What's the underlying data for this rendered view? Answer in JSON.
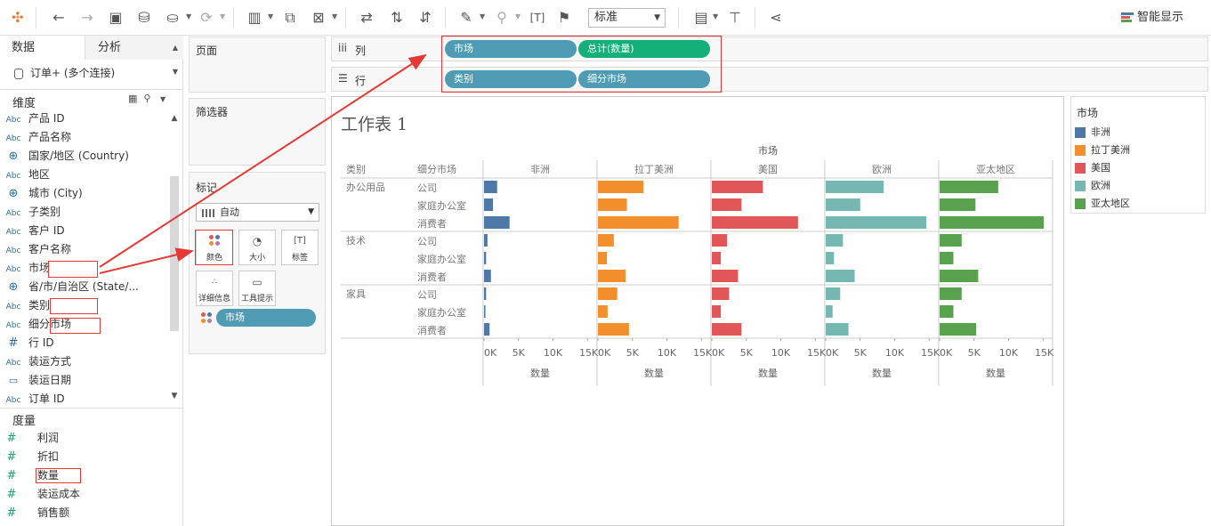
{
  "toolbar": {
    "fit_value": "标准",
    "show_me_label": "智能显示",
    "icons": [
      "tableau-logo-icon",
      "undo-icon",
      "redo-icon",
      "save-icon",
      "new-datasource-icon",
      "pause-update-icon",
      "refresh-icon",
      "new-worksheet-icon",
      "duplicate-icon",
      "clear-sheet-icon",
      "swap-icon",
      "sort-ascending-icon",
      "sort-descending-icon",
      "highlight-icon",
      "group-icon",
      "label-icon",
      "pin-icon",
      "show-cards-icon",
      "presentation-icon",
      "share-icon"
    ]
  },
  "data_pane": {
    "tab_data": "数据",
    "tab_analysis": "分析",
    "datasource": "订单+ (多个连接)",
    "dimensions_header": "维度",
    "dimensions": [
      {
        "type": "Abc",
        "name": "产品 ID"
      },
      {
        "type": "Abc",
        "name": "产品名称"
      },
      {
        "type": "geo",
        "name": "国家/地区 (Country)"
      },
      {
        "type": "Abc",
        "name": "地区"
      },
      {
        "type": "geo",
        "name": "城市 (City)"
      },
      {
        "type": "Abc",
        "name": "子类别"
      },
      {
        "type": "Abc",
        "name": "客户 ID"
      },
      {
        "type": "Abc",
        "name": "客户名称"
      },
      {
        "type": "Abc",
        "name": "市场"
      },
      {
        "type": "geo",
        "name": "省/市/自治区 (State/..."
      },
      {
        "type": "Abc",
        "name": "类别"
      },
      {
        "type": "Abc",
        "name": "细分市场"
      },
      {
        "type": "#",
        "name": "行 ID"
      },
      {
        "type": "Abc",
        "name": "装运方式"
      },
      {
        "type": "cal",
        "name": "装运日期"
      },
      {
        "type": "Abc",
        "name": "订单 ID"
      }
    ],
    "measures_header": "度量",
    "measures": [
      "利润",
      "折扣",
      "数量",
      "装运成本",
      "销售额"
    ]
  },
  "cards": {
    "pages_title": "页面",
    "filters_title": "筛选器",
    "marks_title": "标记",
    "mark_type": "自动",
    "mark_buttons": [
      "颜色",
      "大小",
      "标签",
      "详细信息",
      "工具提示"
    ],
    "color_pill": "市场"
  },
  "shelves": {
    "columns_label": "列",
    "rows_label": "行",
    "column_pills": [
      "市场",
      "总计(数量)"
    ],
    "row_pills": [
      "类别",
      "细分市场"
    ]
  },
  "view": {
    "sheet_title": "工作表 1",
    "top_header": "市场",
    "row_header_category": "类别",
    "row_header_segment": "细分市场"
  },
  "legend": {
    "title": "市场",
    "items": [
      {
        "name": "非洲",
        "color": "#4e79a7"
      },
      {
        "name": "拉丁美洲",
        "color": "#f28e2b"
      },
      {
        "name": "美国",
        "color": "#e15759"
      },
      {
        "name": "欧洲",
        "color": "#76b7b2"
      },
      {
        "name": "亚太地区",
        "color": "#59a14f"
      }
    ]
  },
  "chart_data": {
    "type": "bar",
    "orientation": "horizontal",
    "measure": "数量",
    "panes": [
      "非洲",
      "拉丁美洲",
      "美国",
      "欧洲",
      "亚太地区"
    ],
    "pane_colors": [
      "#4e79a7",
      "#f28e2b",
      "#e15759",
      "#76b7b2",
      "#59a14f"
    ],
    "xlim": [
      0,
      16000
    ],
    "ticks": [
      0,
      5000,
      10000,
      15000
    ],
    "tick_labels": [
      "0K",
      "5K",
      "10K",
      "15K"
    ],
    "xlabel": "数量",
    "categories": [
      {
        "name": "办公用品",
        "segments": [
          "公司",
          "家庭办公室",
          "消费者"
        ]
      },
      {
        "name": "技术",
        "segments": [
          "公司",
          "家庭办公室",
          "消费者"
        ]
      },
      {
        "name": "家具",
        "segments": [
          "公司",
          "家庭办公室",
          "消费者"
        ]
      }
    ],
    "rows": [
      {
        "category": "办公用品",
        "segment": "公司"
      },
      {
        "category": "办公用品",
        "segment": "家庭办公室"
      },
      {
        "category": "办公用品",
        "segment": "消费者"
      },
      {
        "category": "技术",
        "segment": "公司"
      },
      {
        "category": "技术",
        "segment": "家庭办公室"
      },
      {
        "category": "技术",
        "segment": "消费者"
      },
      {
        "category": "家具",
        "segment": "公司"
      },
      {
        "category": "家具",
        "segment": "家庭办公室"
      },
      {
        "category": "家具",
        "segment": "消费者"
      }
    ],
    "series": [
      {
        "name": "非洲",
        "values": [
          1900,
          1300,
          3700,
          500,
          300,
          1000,
          300,
          200,
          800
        ]
      },
      {
        "name": "拉丁美洲",
        "values": [
          6600,
          4200,
          11700,
          2300,
          1300,
          4000,
          2800,
          1400,
          4500
        ]
      },
      {
        "name": "美国",
        "values": [
          7400,
          4300,
          12500,
          2200,
          1300,
          3800,
          2500,
          1300,
          4300
        ]
      },
      {
        "name": "欧洲",
        "values": [
          8400,
          5000,
          14600,
          2500,
          1200,
          4200,
          2100,
          1000,
          3300
        ]
      },
      {
        "name": "亚太地区",
        "values": [
          8500,
          5200,
          15100,
          3200,
          2000,
          5600,
          3200,
          2000,
          5300
        ]
      }
    ]
  }
}
